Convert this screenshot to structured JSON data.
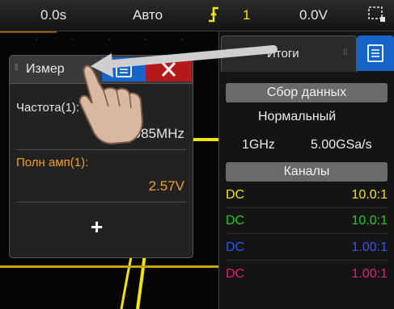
{
  "topbar": {
    "time_offset": "0.0s",
    "trigger_mode": "Авто",
    "trigger_source": "1",
    "trigger_level": "0.0V"
  },
  "measure_panel": {
    "title": "Измер",
    "measurements": [
      {
        "label": "Частота(1):",
        "value": "4.985MHz",
        "color": "#e6e6e6"
      },
      {
        "label": "Полн амп(1):",
        "value": "2.57V",
        "color": "#f0a020"
      }
    ],
    "add_label": "+"
  },
  "summary_panel": {
    "tab_label": "Итоги",
    "acquisition_header": "Сбор данных",
    "acquisition_mode": "Нормальный",
    "bandwidth": "1GHz",
    "sample_rate": "5.00GSa/s",
    "channels_header": "Каналы",
    "channels": [
      {
        "coupling": "DC",
        "probe": "10.0:1",
        "color": "#f2e600"
      },
      {
        "coupling": "DC",
        "probe": "10.0:1",
        "color": "#22cc22"
      },
      {
        "coupling": "DC",
        "probe": "1.00:1",
        "color": "#3355ee"
      },
      {
        "coupling": "DC",
        "probe": "1.00:1",
        "color": "#e0207a"
      }
    ]
  },
  "colors": {
    "ch1_trace": "#f2e600",
    "accent_blue": "#1565c8",
    "close_red": "#b51a1a"
  }
}
